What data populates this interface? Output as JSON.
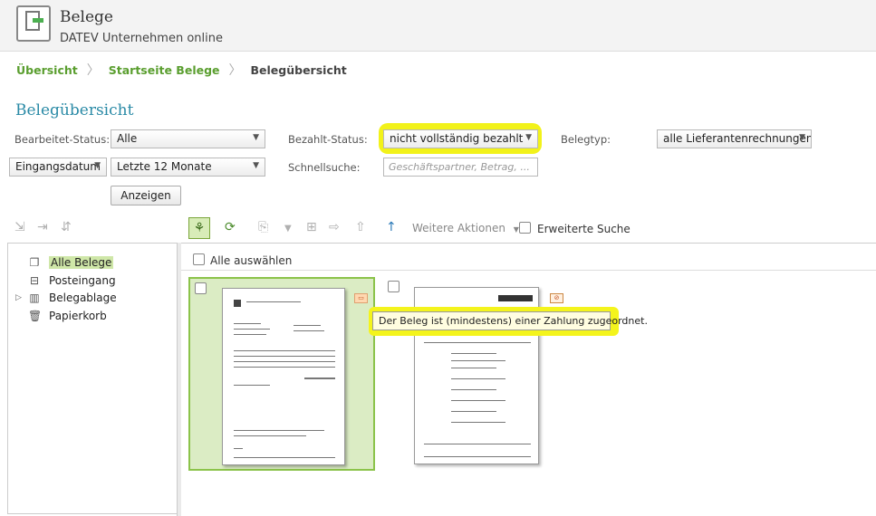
{
  "app": {
    "title": "Belege",
    "subtitle": "DATEV Unternehmen online"
  },
  "breadcrumb": {
    "items": [
      "Übersicht",
      "Startseite Belege"
    ],
    "current": "Belegübersicht"
  },
  "page": {
    "title": "Belegübersicht"
  },
  "filters": {
    "bearbeitet_label": "Bearbeitet-Status:",
    "bearbeitet_value": "Alle",
    "bezahlt_label": "Bezahlt-Status:",
    "bezahlt_value": "nicht vollständig bezahlt",
    "belegtyp_label": "Belegtyp:",
    "belegtyp_value": "alle Lieferantenrechnungen",
    "date_field_value": "Eingangsdatum",
    "date_range_value": "Letzte 12 Monate",
    "schnellsuche_label": "Schnellsuche:",
    "schnellsuche_placeholder": "Geschäftspartner, Betrag, ...",
    "show_button": "Anzeigen"
  },
  "toolbar": {
    "more_actions": "Weitere Aktionen",
    "extended_search": "Erweiterte Suche"
  },
  "sidebar": {
    "items": [
      "Alle Belege",
      "Posteingang",
      "Belegablage",
      "Papierkorb"
    ]
  },
  "content": {
    "select_all": "Alle auswählen",
    "tooltip": "Der Beleg ist (mindestens) einer Zahlung zugeordnet."
  },
  "colors": {
    "accent_green": "#5a9e2f",
    "title_blue": "#2a8aa6",
    "highlight": "#f2f21a"
  }
}
